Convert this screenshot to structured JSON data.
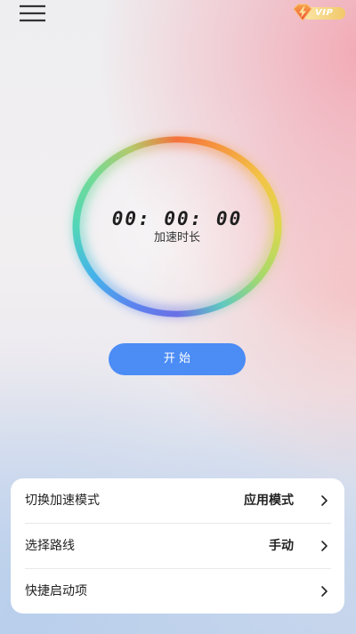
{
  "header": {
    "menu_icon": "hamburger-menu-icon",
    "vip": {
      "icon": "diamond-lightning-icon",
      "label": "VIP"
    }
  },
  "timer": {
    "elapsed": "00: 00: 00",
    "label": "加速时长"
  },
  "start_button": {
    "label": "开 始"
  },
  "settings": {
    "items": [
      {
        "label": "切换加速模式",
        "value": "应用模式",
        "icon": "chevron-right-icon"
      },
      {
        "label": "选择路线",
        "value": "手动",
        "icon": "chevron-right-icon"
      },
      {
        "label": "快捷启动项",
        "icon": "chevron-right-icon"
      }
    ]
  },
  "colors": {
    "accent": "#4b8cf5",
    "text_primary": "#222222",
    "card_background": "#ffffff",
    "divider": "#e8e8e8",
    "vip_gold": "#f2c86a",
    "vip_gem": "#ee4e34",
    "ring": [
      "#f4723b",
      "#f59a3f",
      "#f3c447",
      "#dcd84c",
      "#a8d96a",
      "#5fc9bf",
      "#6a6fe6",
      "#5b84ee",
      "#45b3ea",
      "#52d6b8",
      "#72da96",
      "#b5c86a"
    ]
  }
}
